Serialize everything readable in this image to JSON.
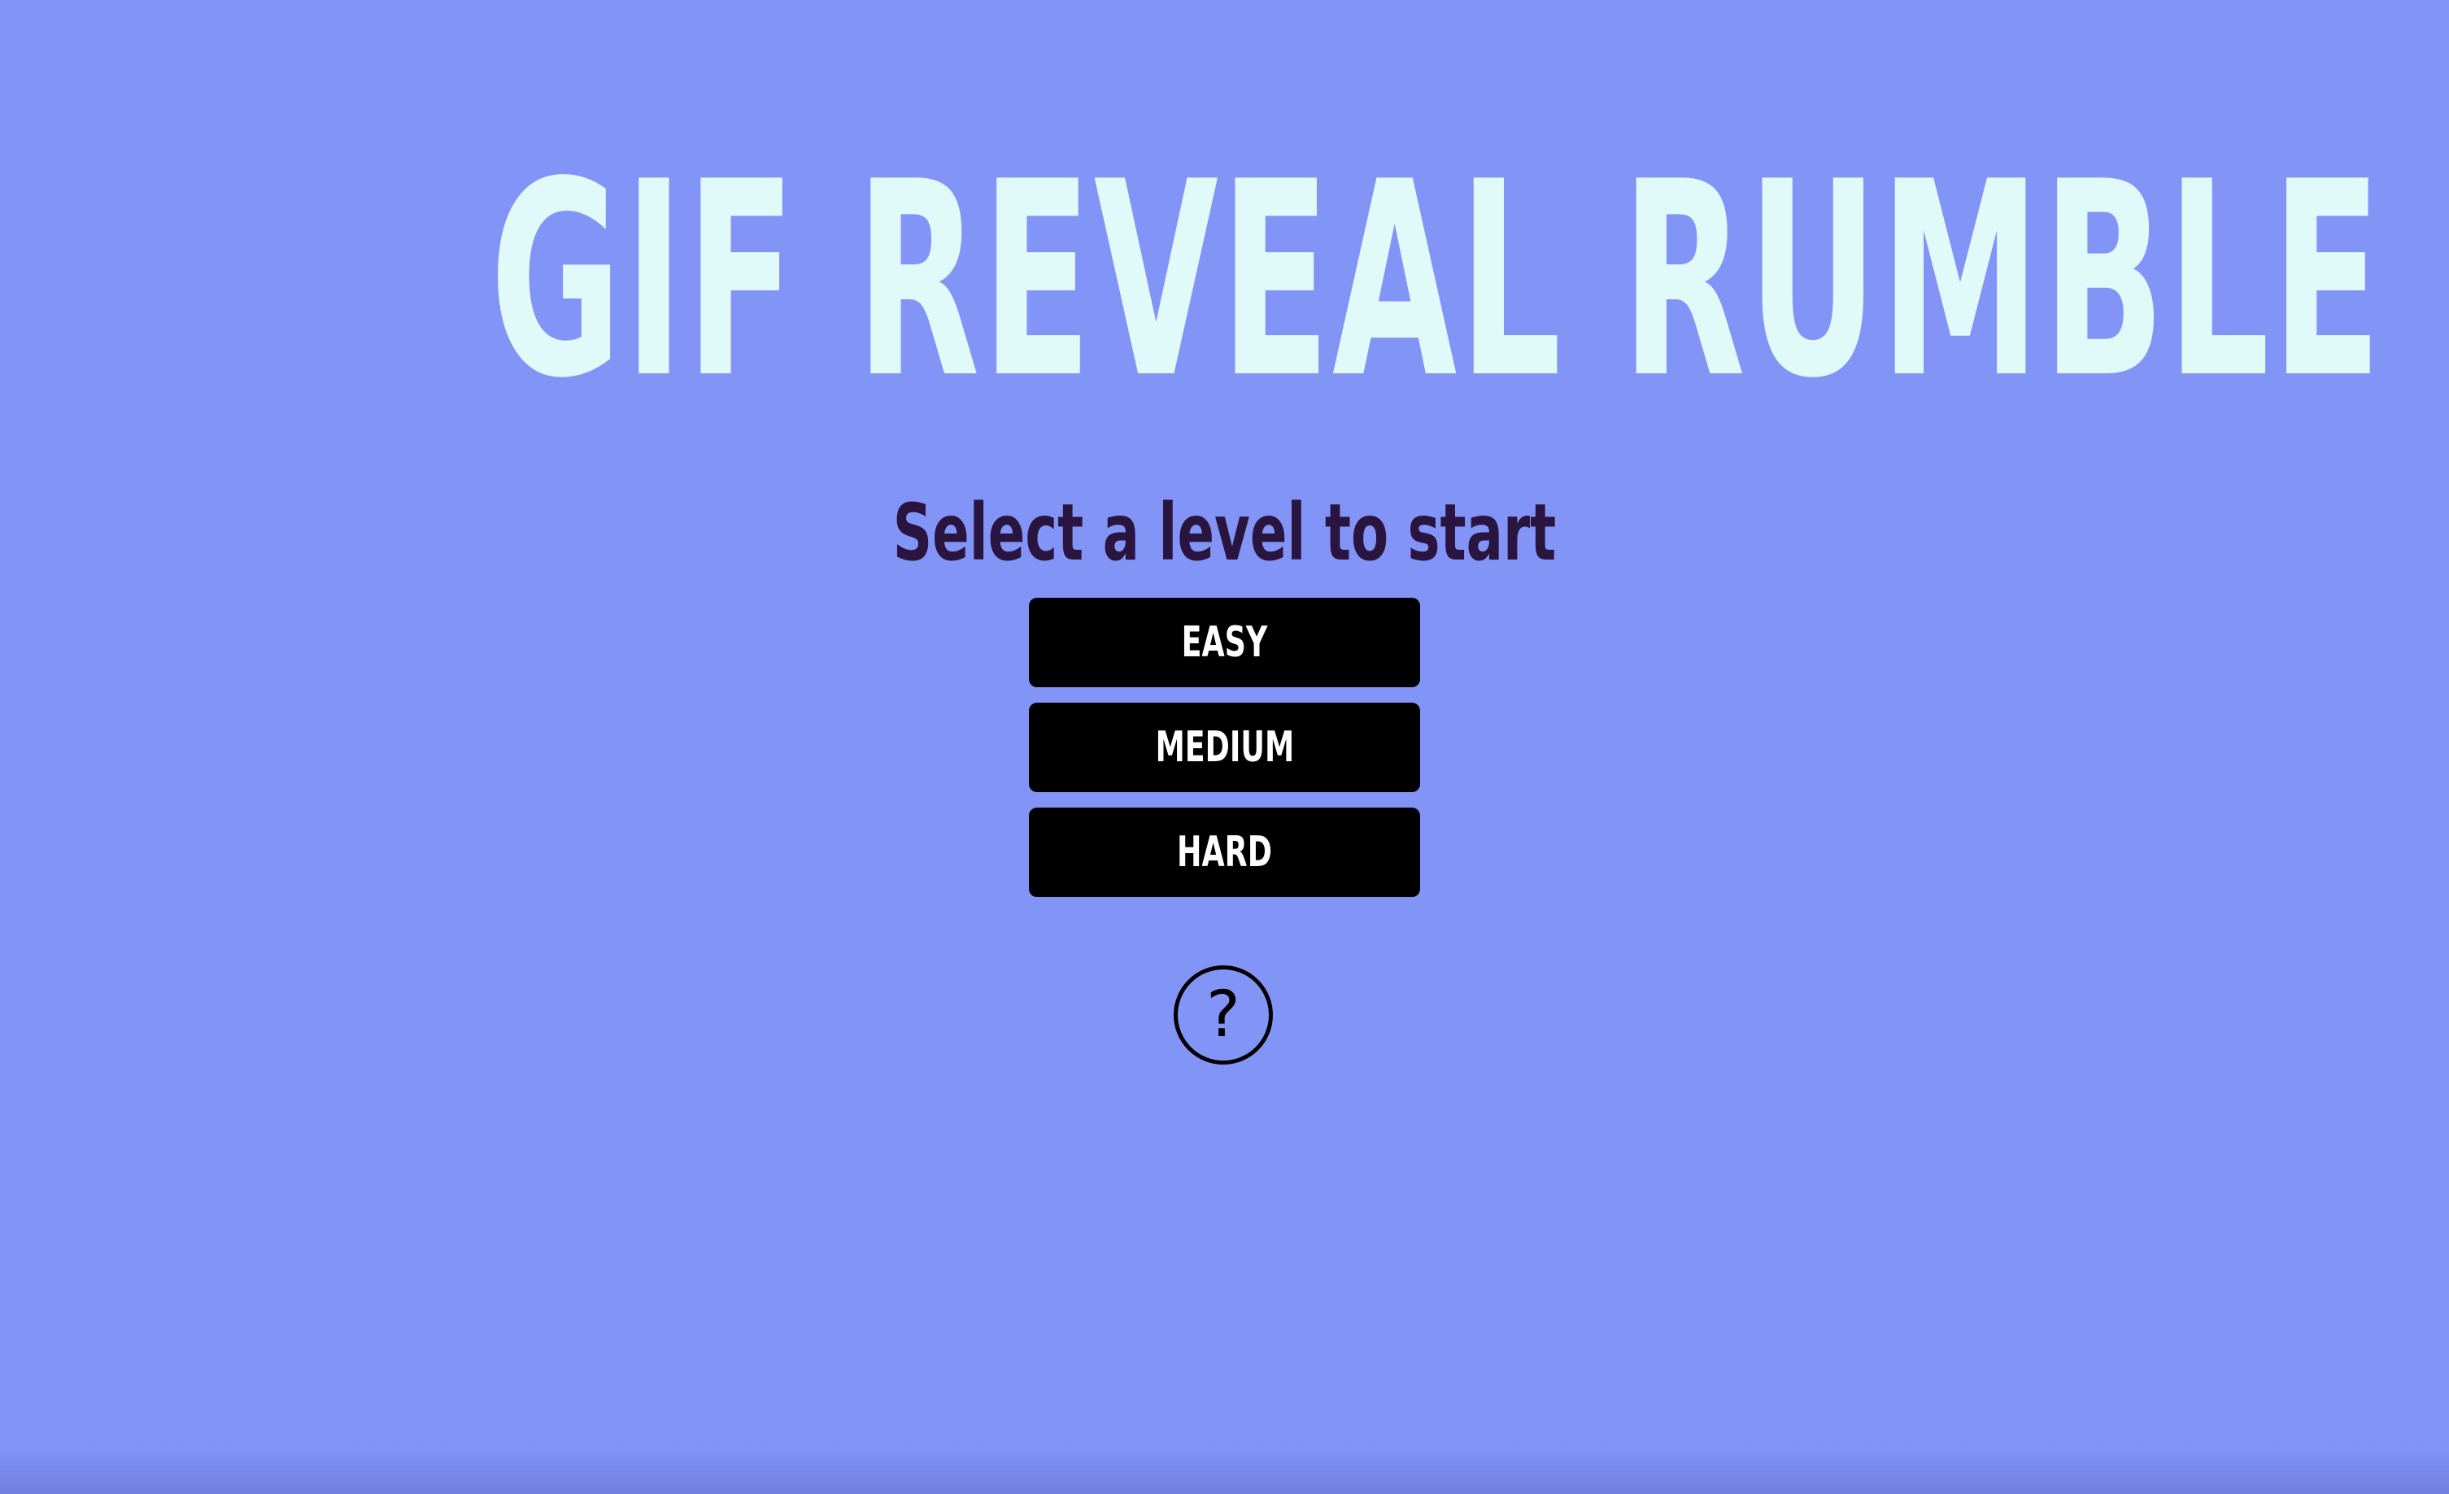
{
  "title": "GIF REVEAL RUMBLE",
  "subtitle": "Select a level to start",
  "levels": [
    {
      "label": "EASY"
    },
    {
      "label": "MEDIUM"
    },
    {
      "label": "HARD"
    }
  ],
  "help": {
    "icon": "question-mark-icon",
    "glyph": "?"
  },
  "colors": {
    "background": "#8394f7",
    "title": "#e0fafa",
    "subtitle": "#2a1540",
    "button_bg": "#000000",
    "button_text": "#ffffff"
  }
}
